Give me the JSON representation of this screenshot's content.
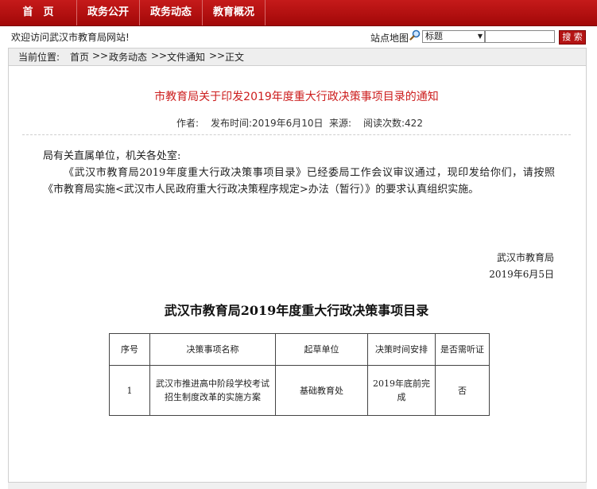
{
  "nav": {
    "items": [
      "首　页",
      "政务公开",
      "政务动态",
      "教育概况"
    ]
  },
  "topbar": {
    "welcome": "欢迎访问武汉市教育局网站!",
    "sitemap": "站点地图",
    "select_value": "标题",
    "search_value": "",
    "search_button": "搜 索"
  },
  "breadcrumb": {
    "label": "当前位置:",
    "items": [
      "首页",
      "政务动态",
      "文件通知",
      "正文"
    ],
    "separator": ">>"
  },
  "article": {
    "title": "市教育局关于印发2019年度重大行政决策事项目录的通知",
    "author_label": "作者:",
    "publish_time": "发布时间:2019年6月10日",
    "source_label": "来源:",
    "read_count": "阅读次数:422",
    "salutation": "局有关直属单位，机关各处室:",
    "paragraph": "《武汉市教育局2019年度重大行政决策事项目录》已经委局工作会议审议通过，现印发给你们，请按照《市教育局实施<武汉市人民政府重大行政决策程序规定>办法（暂行）》的要求认真组织实施。",
    "signature_org": "武汉市教育局",
    "signature_date": "2019年6月5日"
  },
  "decision_list": {
    "title": "武汉市教育局2019年度重大行政决策事项目录",
    "headers": [
      "序号",
      "决策事项名称",
      "起草单位",
      "决策时间安排",
      "是否需听证"
    ],
    "rows": [
      [
        "1",
        "武汉市推进高中阶段学校考试招生制度改革的实施方案",
        "基础教育处",
        "2019年底前完成",
        "否"
      ]
    ]
  },
  "colors": {
    "nav_red": "#b41414",
    "title_red": "#cc1d1d"
  }
}
